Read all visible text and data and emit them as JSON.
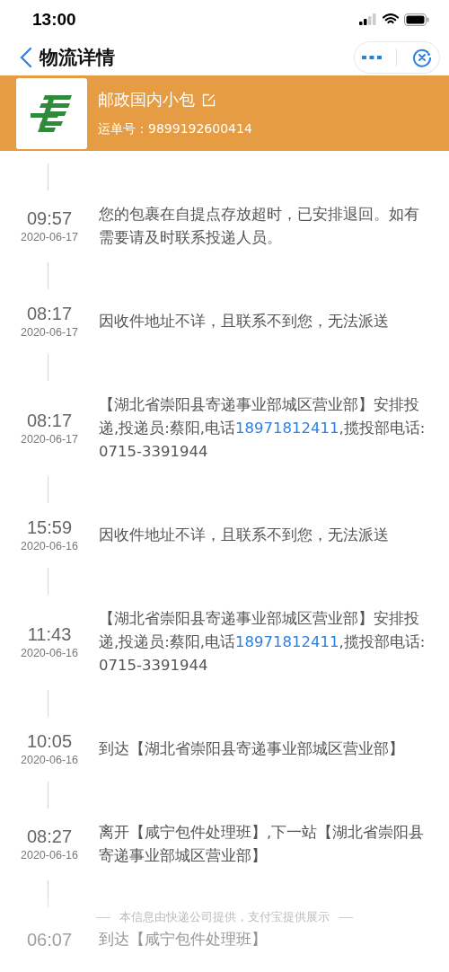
{
  "status_bar": {
    "time": "13:00"
  },
  "nav": {
    "title": "物流详情"
  },
  "package": {
    "name": "邮政国内小包",
    "tracking_label": "运单号：",
    "tracking_number": "9899192600414"
  },
  "events": [
    {
      "time": "09:57",
      "date": "2020-06-17",
      "kind": "normal",
      "segments": [
        {
          "kind": "plain",
          "text": "您的包裹在自提点存放超时，已安排退回。如有需要请及时联系投递人员。"
        }
      ]
    },
    {
      "time": "08:17",
      "date": "2020-06-17",
      "kind": "normal",
      "segments": [
        {
          "kind": "plain",
          "text": "因收件地址不详，且联系不到您，无法派送"
        }
      ]
    },
    {
      "time": "08:17",
      "date": "2020-06-17",
      "kind": "normal",
      "segments": [
        {
          "kind": "plain",
          "text": "【湖北省崇阳县寄递事业部城区营业部】安排投递,投递员:蔡阳,电话"
        },
        {
          "kind": "phone",
          "text": "18971812411"
        },
        {
          "kind": "plain",
          "text": ",揽投部电话:0715-3391944"
        }
      ]
    },
    {
      "time": "15:59",
      "date": "2020-06-16",
      "kind": "normal",
      "segments": [
        {
          "kind": "plain",
          "text": "因收件地址不详，且联系不到您，无法派送"
        }
      ]
    },
    {
      "time": "11:43",
      "date": "2020-06-16",
      "kind": "normal",
      "segments": [
        {
          "kind": "plain",
          "text": "【湖北省崇阳县寄递事业部城区营业部】安排投递,投递员:蔡阳,电话"
        },
        {
          "kind": "phone",
          "text": "18971812411"
        },
        {
          "kind": "plain",
          "text": ",揽投部电话:0715-3391944"
        }
      ]
    },
    {
      "time": "10:05",
      "date": "2020-06-16",
      "kind": "normal",
      "segments": [
        {
          "kind": "plain",
          "text": "到达【湖北省崇阳县寄递事业部城区营业部】"
        }
      ]
    },
    {
      "time": "08:27",
      "date": "2020-06-16",
      "kind": "normal",
      "segments": [
        {
          "kind": "plain",
          "text": "离开【咸宁包件处理班】,下一站【湖北省崇阳县寄递事业部城区营业部】"
        }
      ]
    },
    {
      "time": "06:07",
      "kind": "faded",
      "segments": [
        {
          "kind": "plain",
          "text": "到达【咸宁包件处理班】"
        }
      ]
    }
  ],
  "footer_note": "本信息由快递公司提供，支付宝提供展示"
}
